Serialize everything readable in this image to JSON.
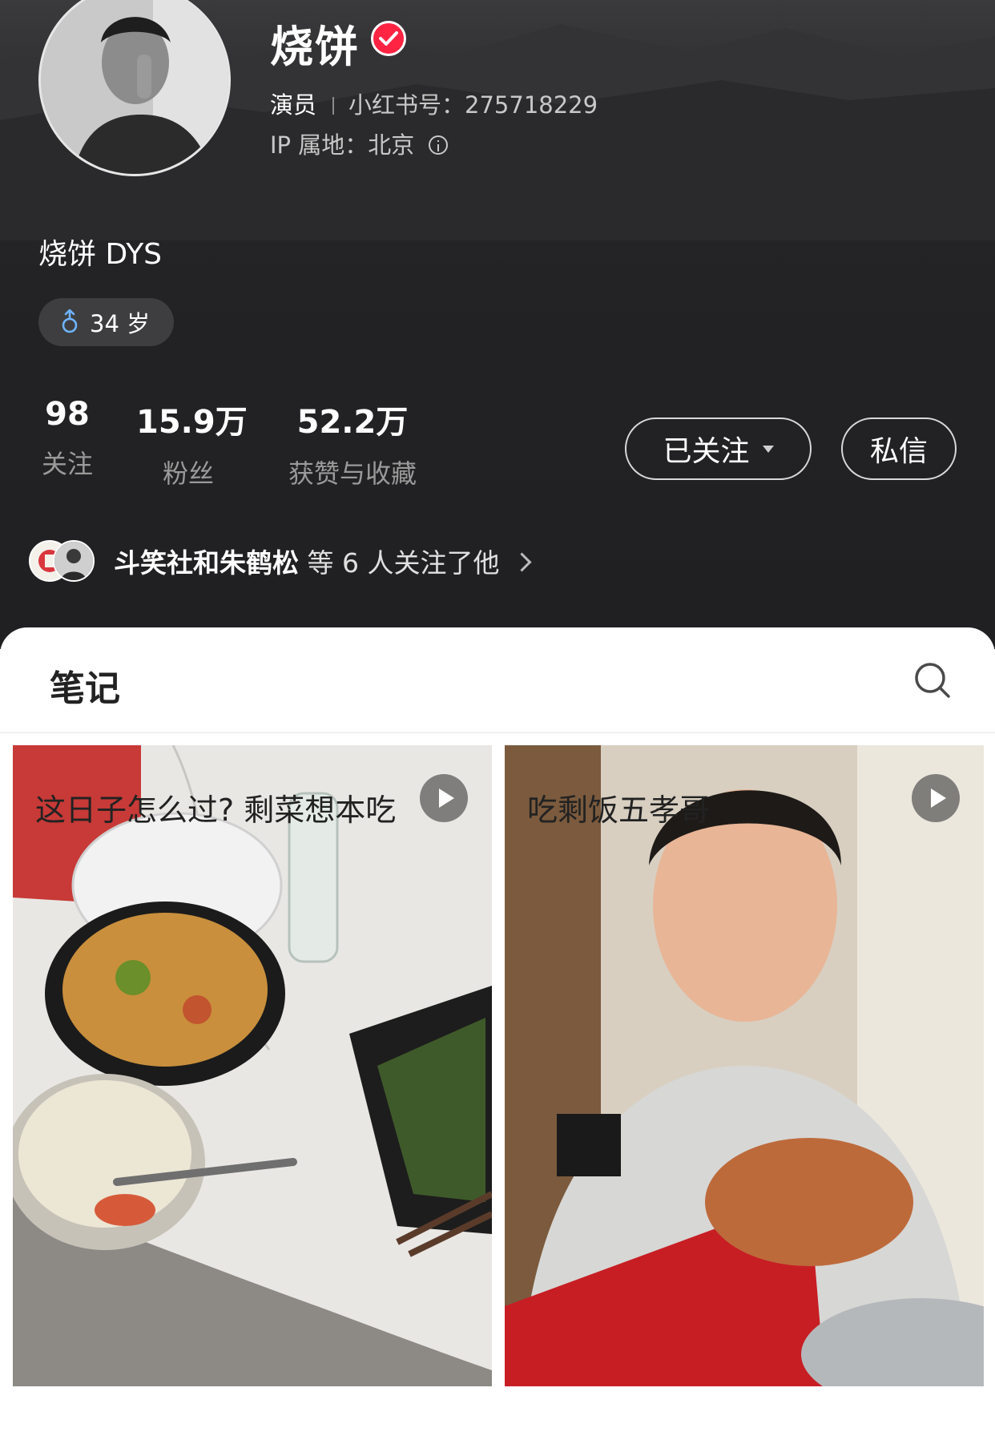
{
  "profile": {
    "name": "烧饼",
    "role": "演员",
    "id_text": "小红书号：275718229",
    "ip_text": "IP 属地：北京",
    "bio": "烧饼 DYS",
    "age_tag": "34 岁",
    "verified_icon": "verified-check-icon",
    "gender_icon": "male-icon"
  },
  "stats": [
    {
      "value": "98",
      "label": "关注"
    },
    {
      "value": "15.9万",
      "label": "粉丝"
    },
    {
      "value": "52.2万",
      "label": "获赞与收藏"
    }
  ],
  "actions": {
    "follow_label": "已关注",
    "message_label": "私信"
  },
  "mutual": {
    "names": "斗笑社和朱鹤松",
    "rest": " 等 6 人关注了他"
  },
  "notes": {
    "tab_label": "笔记",
    "cards": [
      {
        "title": "这日子怎么过?  剩菜想本吃",
        "type": "video"
      },
      {
        "title": "吃剩饭五孝哥",
        "type": "video"
      }
    ]
  },
  "colors": {
    "header_bg": "#232325",
    "brand_red": "#ff2442",
    "button_border": "#d9d9d9"
  }
}
